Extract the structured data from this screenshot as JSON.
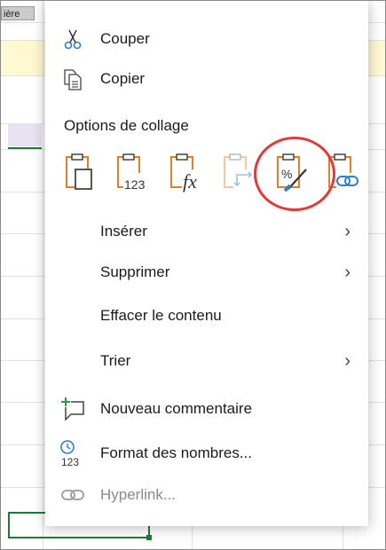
{
  "sheet": {
    "column_header_fragment": "ière"
  },
  "menu": {
    "items_top": [
      {
        "name": "cut",
        "label": "Couper",
        "icon": "scissors-icon"
      },
      {
        "name": "copy",
        "label": "Copier",
        "icon": "copy-icon"
      }
    ],
    "paste_options_title": "Options de collage",
    "paste_options": [
      {
        "name": "paste",
        "icon": "paste-icon"
      },
      {
        "name": "paste-values",
        "icon": "paste-values-icon",
        "badge": "123"
      },
      {
        "name": "paste-formulas",
        "icon": "paste-formulas-icon",
        "badge": "fx"
      },
      {
        "name": "paste-transpose",
        "icon": "paste-transpose-icon"
      },
      {
        "name": "paste-formatting",
        "icon": "paste-formatting-icon"
      },
      {
        "name": "paste-link",
        "icon": "paste-link-icon",
        "highlighted": true
      }
    ],
    "items_mid": [
      {
        "name": "insert",
        "label": "Insérer",
        "submenu": true
      },
      {
        "name": "delete",
        "label": "Supprimer",
        "submenu": true
      },
      {
        "name": "clear-contents",
        "label": "Effacer le contenu",
        "submenu": false
      },
      {
        "name": "sort",
        "label": "Trier",
        "submenu": true
      }
    ],
    "items_bottom": [
      {
        "name": "new-comment",
        "label": "Nouveau commentaire",
        "icon": "new-comment-icon"
      },
      {
        "name": "number-format",
        "label": "Format des nombres...",
        "icon": "number-format-icon",
        "badge": "123"
      },
      {
        "name": "hyperlink",
        "label": "Hyperlink...",
        "icon": "link-icon",
        "disabled": true
      }
    ],
    "chevron_glyph": "›",
    "accent_orange": "#d9822b",
    "highlight_color": "#e23b3b"
  }
}
